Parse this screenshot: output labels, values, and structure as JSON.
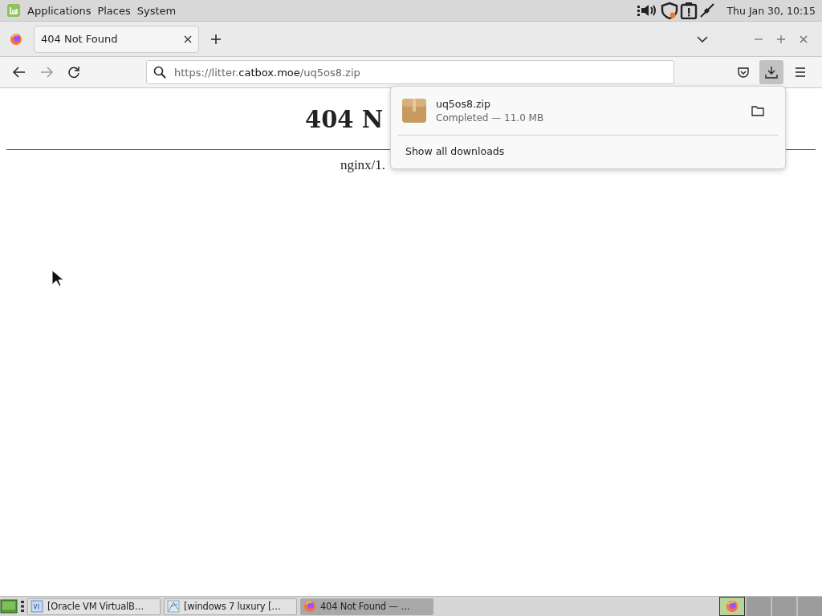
{
  "top_panel": {
    "menus": [
      "Applications",
      "Places",
      "System"
    ],
    "clock": "Thu Jan 30, 10:15"
  },
  "browser": {
    "tabs": [
      {
        "label": "404 Not Found",
        "selected": true
      }
    ],
    "url": {
      "prefix": "https://litter.",
      "domain": "catbox.moe",
      "path": "/uq5os8.zip"
    },
    "downloads_button": {
      "selected": true
    }
  },
  "page": {
    "heading": "404 N",
    "footer": "nginx/1."
  },
  "downloads_panel": {
    "items": [
      {
        "name": "uq5os8.zip",
        "status": "Completed — 11.0 MB"
      }
    ],
    "show_all": "Show all downloads"
  },
  "taskbar": {
    "windows": [
      {
        "label": "[Oracle VM VirtualB…",
        "selected": false,
        "kind": "vm"
      },
      {
        "label": "[windows 7 luxury […",
        "selected": false,
        "kind": "image"
      },
      {
        "label": "404 Not Found — …",
        "selected": true,
        "kind": "browser"
      }
    ],
    "workspaces": [
      {
        "selected": true
      },
      {
        "selected": false
      },
      {
        "selected": false
      },
      {
        "selected": false
      }
    ]
  }
}
